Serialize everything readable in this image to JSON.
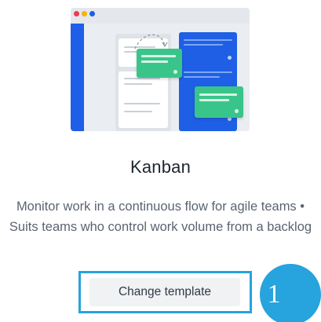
{
  "template": {
    "name": "Kanban",
    "description": "Monitor work in a continuous flow for agile teams • Suits teams who control work volume from a backlog",
    "button_label": "Change template"
  },
  "annotation": {
    "step_number": "1"
  },
  "illustration": {
    "name": "kanban-board-illustration",
    "window_dot_colors": [
      "#f03a4f",
      "#f5b400",
      "#1f5ee8"
    ]
  },
  "colors": {
    "accent_highlight": "#27a3dd",
    "board_blue": "#1e5fe6",
    "card_green": "#39c58a",
    "title_text": "#1d2530",
    "body_text": "#5a6472"
  }
}
